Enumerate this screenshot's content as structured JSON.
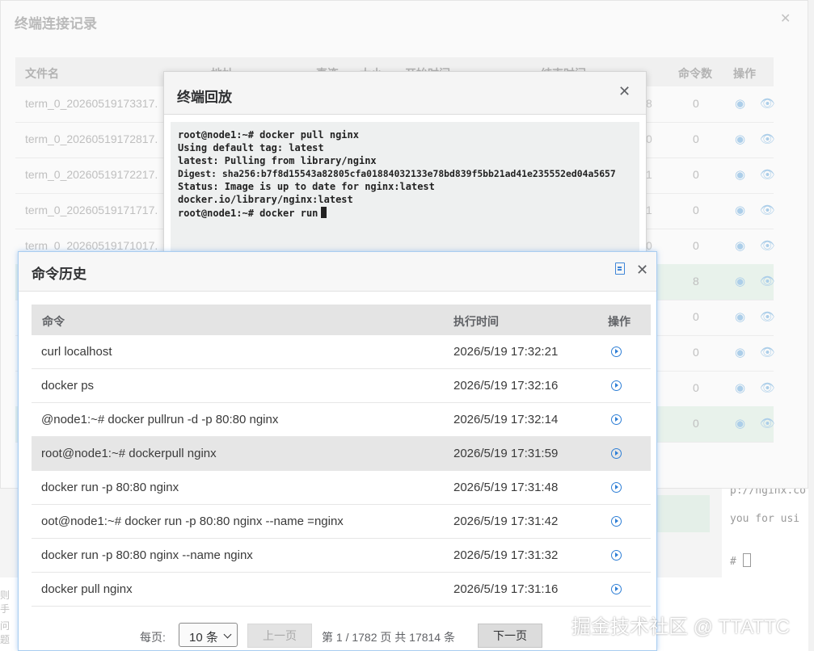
{
  "connection_dialog": {
    "title": "终端连接记录",
    "columns": [
      "文件名",
      "地址",
      "直连",
      "大小",
      "开始时间",
      "结束时间",
      "命令数",
      "操作"
    ],
    "rows": [
      {
        "file": "term_0_20260519173317.",
        "extra": "8",
        "commands": "0"
      },
      {
        "file": "term_0_20260519172817.",
        "extra": "0",
        "commands": "0"
      },
      {
        "file": "term_0_20260519172217.",
        "extra": "1",
        "commands": "0"
      },
      {
        "file": "term_0_20260519171717.",
        "extra": "1",
        "commands": "0"
      },
      {
        "file": "term_0_20260519171017.",
        "extra": "0",
        "commands": "0"
      },
      {
        "file": "",
        "extra": "",
        "commands": "8"
      },
      {
        "file": "",
        "extra": "",
        "commands": "0"
      },
      {
        "file": "",
        "extra": "",
        "commands": "0"
      },
      {
        "file": "",
        "extra": "",
        "commands": "0"
      },
      {
        "file": "",
        "extra": "",
        "commands": "0"
      }
    ]
  },
  "playback_dialog": {
    "title": "终端回放",
    "terminal_lines": [
      "root@node1:~# docker pull nginx",
      "Using default tag: latest",
      "latest: Pulling from library/nginx",
      "Digest: sha256:b7f8d15543a82805cfa01884032133e78bd839f5bb21ad41e235552ed04a5657",
      "Status: Image is up to date for nginx:latest",
      "docker.io/library/nginx:latest",
      "root@node1:~# docker run"
    ]
  },
  "history_dialog": {
    "title": "命令历史",
    "columns": {
      "command": "命令",
      "time": "执行时间",
      "action": "操作"
    },
    "rows": [
      {
        "command": "curl localhost",
        "time": "2026/5/19 17:32:21"
      },
      {
        "command": "docker ps",
        "time": "2026/5/19 17:32:16"
      },
      {
        "command": "@node1:~# docker pullrun -d -p 80:80 nginx",
        "time": "2026/5/19 17:32:14"
      },
      {
        "command": "root@node1:~# dockerpull nginx",
        "time": "2026/5/19 17:31:59"
      },
      {
        "command": "docker run -p 80:80 nginx",
        "time": "2026/5/19 17:31:48"
      },
      {
        "command": "oot@node1:~# docker run -p 80:80 nginx --name =nginx",
        "time": "2026/5/19 17:31:42"
      },
      {
        "command": "docker run -p 80:80 nginx --name nginx",
        "time": "2026/5/19 17:31:32"
      },
      {
        "command": "docker pull nginx",
        "time": "2026/5/19 17:31:16"
      }
    ],
    "selected_row": 3
  },
  "pagination": {
    "per_page_label": "每页:",
    "page_size": "10 条",
    "prev_label": "上一页",
    "page_info": "第 1 / 1782 页 共 17814 条",
    "next_label": "下一页"
  },
  "background_terminal": {
    "lines": [
      "p://nginx.co",
      "you for usi",
      "#"
    ]
  },
  "watermark": "掘金技术社区 @ TTATTC",
  "colors": {
    "accent": "#2f7fd6",
    "highlight_row": "#e8f2eb",
    "terminal_bg": "#eef0f0"
  }
}
